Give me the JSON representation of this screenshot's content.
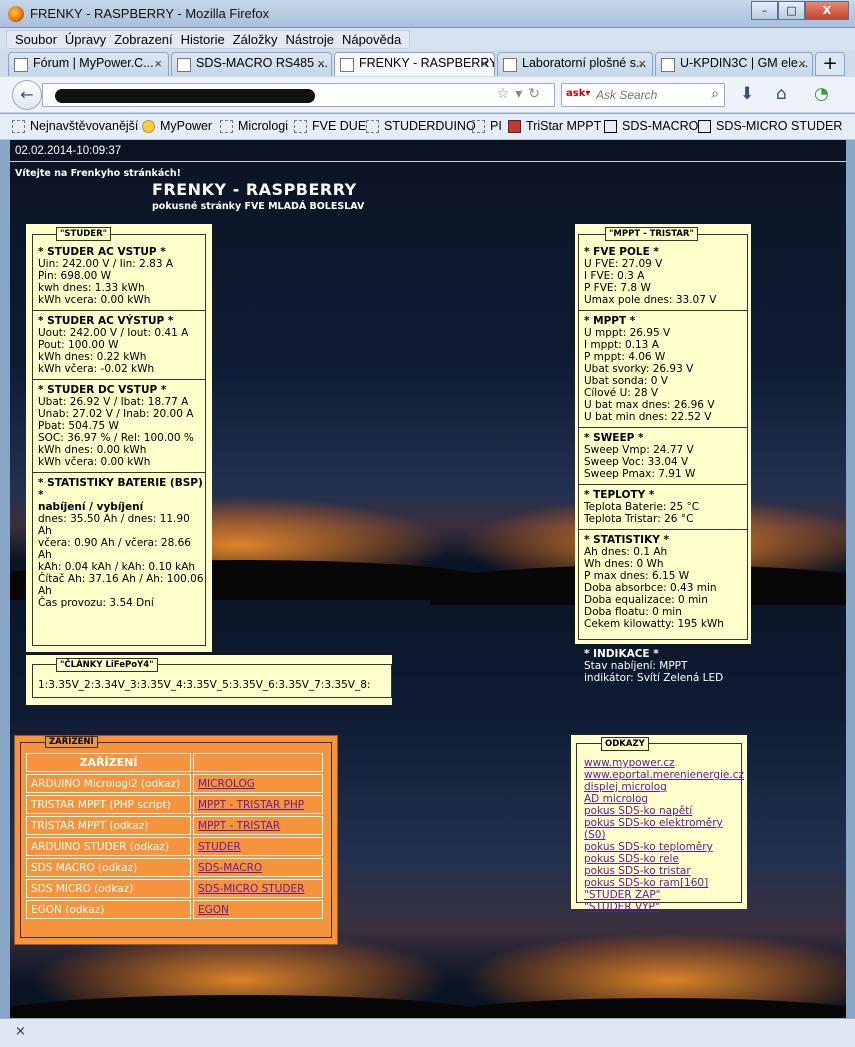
{
  "window": {
    "title": "FRENKY - RASPBERRY - Mozilla Firefox",
    "buttons": [
      "–",
      "□",
      "X"
    ]
  },
  "menu": [
    "Soubor",
    "Úpravy",
    "Zobrazení",
    "Historie",
    "Záložky",
    "Nástroje",
    "Nápověda"
  ],
  "tabs": [
    {
      "label": "Fórum | MyPower.C...",
      "active": false
    },
    {
      "label": "SDS-MACRO RS485 ...",
      "active": false
    },
    {
      "label": "FRENKY - RASPBERRY",
      "active": true
    },
    {
      "label": "Laboratorní plošné s...",
      "active": false
    },
    {
      "label": "U-KPDIN3C | GM ele...",
      "active": false
    }
  ],
  "tab_close": "×",
  "new_tab": "+",
  "search": {
    "placeholder": "Ask Search"
  },
  "bookmarks": [
    "Nejnavštěvovanější",
    "MyPower",
    "Micrologi",
    "FVE DUE",
    "STUDERDUINO",
    "PI",
    "TriStar MPPT",
    "SDS-MACRO",
    "SDS-MICRO STUDER"
  ],
  "page": {
    "datetime": "02.02.2014-10:09:37",
    "welcome": "Vítejte na Frenkyho stránkách!",
    "title": "FRENKY - RASPBERRY",
    "subtitle": "pokusné stránky FVE MLADÁ BOLESLAV"
  },
  "studer": {
    "legend": "\"STUDER\"",
    "blocks": [
      {
        "heading": "* STUDER AC VSTUP *",
        "lines": [
          "Uin: 242.00 V / Iin: 2.83 A",
          "Pin: 698.00 W",
          "kwh dnes: 1.33 kWh",
          "kWh vcera: 0.00 kWh"
        ]
      },
      {
        "heading": "* STUDER AC VÝSTUP *",
        "lines": [
          "Uout: 242.00 V / Iout: 0.41 A",
          "Pout: 100.00 W",
          "kWh dnes: 0.22 kWh",
          "kWh včera: -0.02 kWh"
        ]
      },
      {
        "heading": "* STUDER DC VSTUP *",
        "lines": [
          "Ubat: 26.92 V / Ibat: 18.77 A",
          "Unab: 27.02 V / Inab: 20.00 A",
          "Pbat: 504.75 W",
          "SOC: 36.97 % / Rel: 100.00 %",
          "kWh dnes: 0.00 kWh",
          "kWh včera: 0.00 kWh"
        ]
      },
      {
        "heading": "* STATISTIKY BATERIE (BSP) *",
        "lines": [
          "nabíjení / vybíjení",
          "dnes: 35.50 Ah / dnes: 11.90 Ah",
          "včera: 0.90 Ah / včera: 28.66 Ah",
          "kAh: 0.04 kAh / kAh: 0.10 kAh",
          "Čítač Ah: 37.16 Ah / Ah: 100.06 Ah",
          "Čas provozu: 3.54 Dní"
        ]
      }
    ]
  },
  "cells": {
    "legend": "\"ČLÁNKY LiFePoY4\"",
    "value": "1:3.35V_2:3.34V_3:3.35V_4:3.35V_5:3.35V_6:3.35V_7:3.35V_8:"
  },
  "mppt": {
    "legend": "\"MPPT - TRISTAR\"",
    "blocks": [
      {
        "heading": "* FVE POLE *",
        "lines": [
          "U FVE: 27.09 V",
          "I FVE: 0.3 A",
          "P FVE: 7.8 W",
          "Umax pole dnes: 33.07 V"
        ]
      },
      {
        "heading": "* MPPT *",
        "lines": [
          "U mppt: 26.95 V",
          "I mppt: 0.13 A",
          "P mppt: 4.06 W",
          "Ubat svorky: 26.93 V",
          "Ubat sonda: 0 V",
          "Cílové U: 28 V",
          "U bat max dnes: 26.96 V",
          "U bat min dnes: 22.52 V"
        ]
      },
      {
        "heading": "* SWEEP *",
        "lines": [
          "Sweep Vmp: 24.77 V",
          "Sweep Voc: 33.04 V",
          "Sweep Pmax: 7.91 W"
        ]
      },
      {
        "heading": "* TEPLOTY *",
        "lines": [
          "Teplota Baterie: 25 °C",
          "Teplota Tristar: 26 °C"
        ]
      },
      {
        "heading": "* STATISTIKY *",
        "lines": [
          "Ah dnes: 0.1 Ah",
          "Wh dnes: 0 Wh",
          "P max dnes: 6.15 W",
          "Doba absorbce: 0.43 min",
          "Doba equalizace: 0 min",
          "Doba floatu: 0 min",
          "Cekem kilowatty: 195 kWh"
        ]
      }
    ],
    "indicator": {
      "heading": "* INDIKACE *",
      "lines": [
        "Stav nabíjení: MPPT",
        "indikátor: Svítí Zelená LED"
      ]
    }
  },
  "devices": {
    "legend": "ZAŘÍZENÍ",
    "header": "ZAŘÍZENÍ",
    "rows": [
      {
        "name": "ARDUINO Micrologi2 (odkaz)",
        "link": "MICROLOG"
      },
      {
        "name": "TRISTAR MPPT (PHP script)",
        "link": "MPPT - TRISTAR PHP"
      },
      {
        "name": "TRISTAR MPPT (odkaz)",
        "link": "MPPT - TRISTAR"
      },
      {
        "name": "ARDUINO STUDER (odkaz)",
        "link": "STUDER"
      },
      {
        "name": "SDS MACRO (odkaz)",
        "link": "SDS-MACRO"
      },
      {
        "name": "SDS MICRO (odkaz)",
        "link": "SDS-MICRO STUDER"
      },
      {
        "name": "EGON (odkaz)",
        "link": "EGON"
      }
    ]
  },
  "links": {
    "legend": "ODKAZY",
    "items": [
      "www.mypower.cz",
      "www.eportal.merenienergie.cz",
      "displej microlog",
      "AD microlog",
      "pokus SDS-ko napětí",
      "pokus SDS-ko elektroměry (S0)",
      "pokus SDS-ko teploměry",
      "pokus SDS-ko rele",
      "pokus SDS-ko tristar",
      "pokus SDS-ko ram[160]",
      "\"STUDER ZAP\"",
      "\"STUDER VYP\""
    ]
  },
  "status": {
    "close": "×"
  }
}
